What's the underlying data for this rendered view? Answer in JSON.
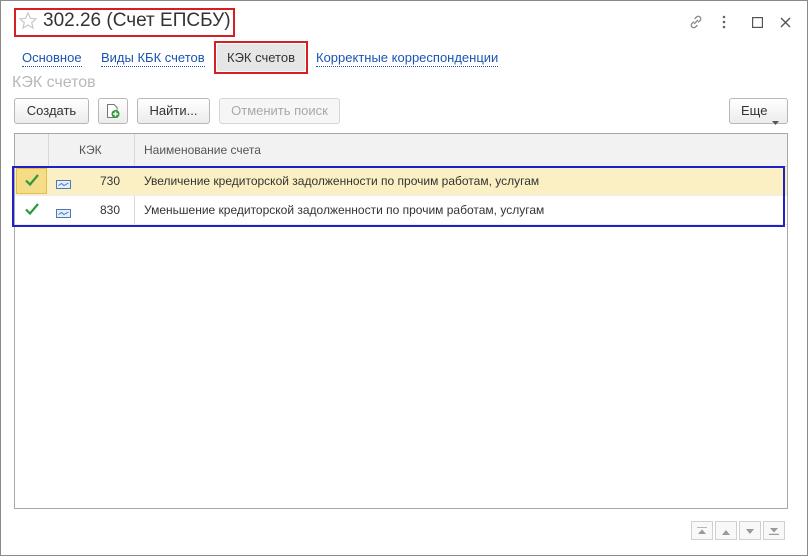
{
  "window": {
    "title": "302.26 (Счет ЕПСБУ)"
  },
  "tabs": [
    {
      "label": "Основное"
    },
    {
      "label": "Виды КБК счетов"
    },
    {
      "label": "КЭК счетов"
    },
    {
      "label": "Корректные корреспонденции"
    }
  ],
  "section": {
    "title": "КЭК счетов"
  },
  "toolbar": {
    "create_label": "Создать",
    "find_label": "Найти...",
    "cancel_search_label": "Отменить поиск",
    "more_label": "Еще"
  },
  "table": {
    "columns": [
      "",
      "КЭК",
      "Наименование счета"
    ],
    "rows": [
      {
        "checked": true,
        "kek": "730",
        "name": "Увеличение кредиторской задолженности по прочим работам, услугам"
      },
      {
        "checked": true,
        "kek": "830",
        "name": "Уменьшение кредиторской задолженности по прочим работам, услугам"
      }
    ]
  },
  "icons": {
    "favorite": "star-icon",
    "link": "link-icon",
    "menu": "more-vert-icon",
    "maximize": "maximize-icon",
    "close": "close-icon",
    "add_copy": "add-copy-icon",
    "check": "check-icon",
    "account": "account-icon"
  },
  "colors": {
    "accent_link": "#1a54b3",
    "selected_row": "#fbefc4",
    "highlight_red": "#d42020",
    "highlight_blue": "#2020c8",
    "check_green": "#2a9a3a"
  }
}
